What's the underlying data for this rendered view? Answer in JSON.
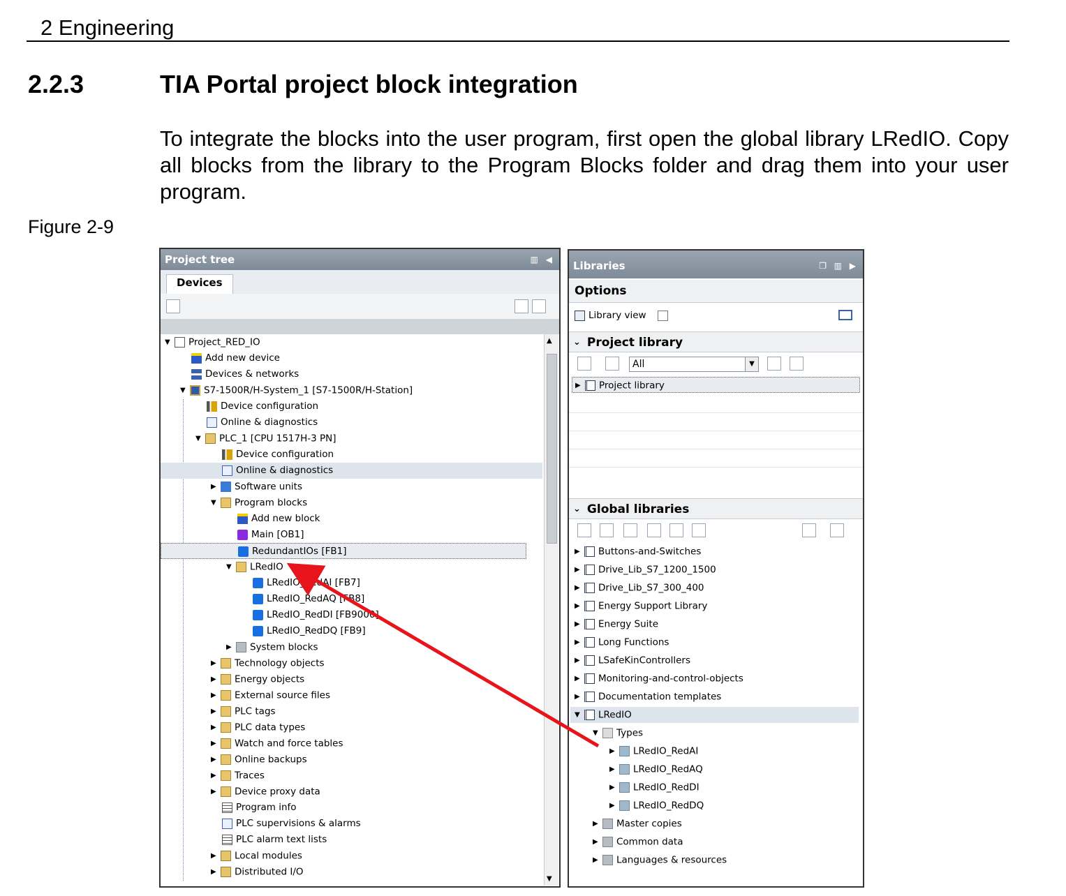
{
  "page_header": "2 Engineering",
  "section": {
    "number": "2.2.3",
    "title": "TIA Portal project block integration"
  },
  "paragraph": "To integrate the blocks into the user program, first open the global library LRedIO. Copy all blocks from the library to the Program Blocks folder and drag them into your user program.",
  "figure_label": "Figure 2-9",
  "project_tree": {
    "title": "Project tree",
    "tab": "Devices",
    "items": [
      {
        "label": "Project_RED_IO"
      },
      {
        "label": "Add new device"
      },
      {
        "label": "Devices & networks"
      },
      {
        "label": "S7-1500R/H-System_1 [S7-1500R/H-Station]"
      },
      {
        "label": "Device configuration"
      },
      {
        "label": "Online & diagnostics"
      },
      {
        "label": "PLC_1 [CPU 1517H-3 PN]"
      },
      {
        "label": "Device configuration"
      },
      {
        "label": "Online & diagnostics"
      },
      {
        "label": "Software units"
      },
      {
        "label": "Program blocks"
      },
      {
        "label": "Add new block"
      },
      {
        "label": "Main [OB1]"
      },
      {
        "label": "RedundantIOs [FB1]"
      },
      {
        "label": "LRedIO"
      },
      {
        "label": "LRedIO_RedAI [FB7]"
      },
      {
        "label": "LRedIO_RedAQ [FB8]"
      },
      {
        "label": "LRedIO_RedDI [FB9000]"
      },
      {
        "label": "LRedIO_RedDQ [FB9]"
      },
      {
        "label": "System blocks"
      },
      {
        "label": "Technology objects"
      },
      {
        "label": "Energy objects"
      },
      {
        "label": "External source files"
      },
      {
        "label": "PLC tags"
      },
      {
        "label": "PLC data types"
      },
      {
        "label": "Watch and force tables"
      },
      {
        "label": "Online backups"
      },
      {
        "label": "Traces"
      },
      {
        "label": "Device proxy data"
      },
      {
        "label": "Program info"
      },
      {
        "label": "PLC supervisions & alarms"
      },
      {
        "label": "PLC alarm text lists"
      },
      {
        "label": "Local modules"
      },
      {
        "label": "Distributed I/O"
      }
    ]
  },
  "libraries": {
    "title": "Libraries",
    "options_label": "Options",
    "library_view_label": "Library view",
    "project_library": {
      "header": "Project library",
      "filter_value": "All",
      "items": [
        {
          "label": "Project library"
        }
      ]
    },
    "global_libraries": {
      "header": "Global libraries",
      "items": [
        {
          "label": "Buttons-and-Switches"
        },
        {
          "label": "Drive_Lib_S7_1200_1500"
        },
        {
          "label": "Drive_Lib_S7_300_400"
        },
        {
          "label": "Energy Support Library"
        },
        {
          "label": "Energy Suite"
        },
        {
          "label": "Long Functions"
        },
        {
          "label": "LSafeKinControllers"
        },
        {
          "label": "Monitoring-and-control-objects"
        },
        {
          "label": "Documentation templates"
        },
        {
          "label": "LRedIO"
        },
        {
          "label": "Types"
        },
        {
          "label": "LRedIO_RedAI"
        },
        {
          "label": "LRedIO_RedAQ"
        },
        {
          "label": "LRedIO_RedDI"
        },
        {
          "label": "LRedIO_RedDQ"
        },
        {
          "label": "Master copies"
        },
        {
          "label": "Common data"
        },
        {
          "label": "Languages & resources"
        }
      ]
    }
  },
  "colors": {
    "annotation_arrow": "#e8141b",
    "title_bar": "#8a96a3"
  }
}
